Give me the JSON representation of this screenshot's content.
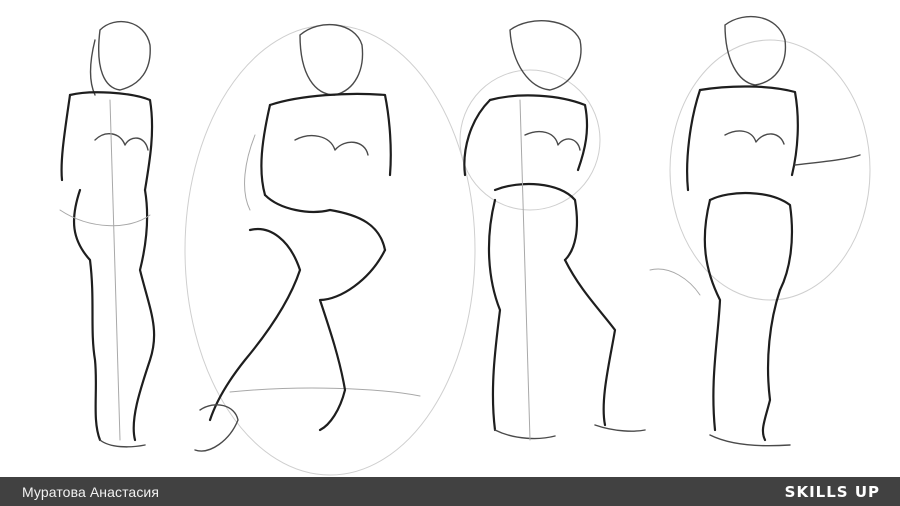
{
  "footer": {
    "author": "Муратова Анастасия",
    "brand": "SKILLS UP",
    "bar_color": "#414141"
  },
  "artwork": {
    "figures": [
      "figure-1",
      "figure-2",
      "figure-3",
      "figure-4"
    ]
  }
}
